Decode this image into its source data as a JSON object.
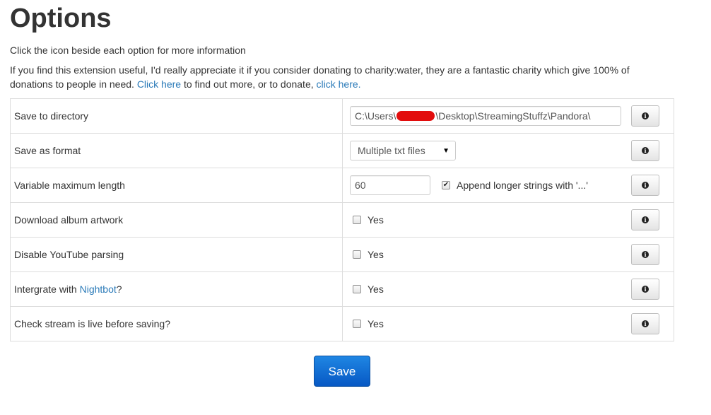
{
  "page": {
    "title": "Options",
    "intro": "Click the icon beside each option for more information",
    "donate": {
      "text_before": "If you find this extension useful, I'd really appreciate it if you consider donating to charity:water, they are a fantastic charity which give 100% of donations to people in need. ",
      "link1": "Click here",
      "text_middle": " to find out more, or to donate, ",
      "link2": "click here."
    }
  },
  "options": {
    "directory": {
      "label": "Save to directory",
      "value_prefix": "C:\\Users\\",
      "value_suffix": "\\Desktop\\StreamingStuffz\\Pandora\\"
    },
    "format": {
      "label": "Save as format",
      "selected": "Multiple txt files"
    },
    "max_length": {
      "label": "Variable maximum length",
      "value": "60",
      "append_label": "Append longer strings with '...'",
      "append_checked": true
    },
    "artwork": {
      "label": "Download album artwork",
      "check_label": "Yes",
      "checked": false
    },
    "youtube": {
      "label": "Disable YouTube parsing",
      "check_label": "Yes",
      "checked": false
    },
    "nightbot": {
      "label_before": "Intergrate with ",
      "label_link": "Nightbot",
      "label_after": "?",
      "check_label": "Yes",
      "checked": false
    },
    "live_check": {
      "label": "Check stream is live before saving?",
      "check_label": "Yes",
      "checked": false
    }
  },
  "info_icon": {
    "name": "info-icon",
    "glyph": "i"
  },
  "save": {
    "label": "Save"
  },
  "colors": {
    "link": "#2a7ab8",
    "save_button": "#0758c4",
    "redaction": "#e20d0d"
  }
}
